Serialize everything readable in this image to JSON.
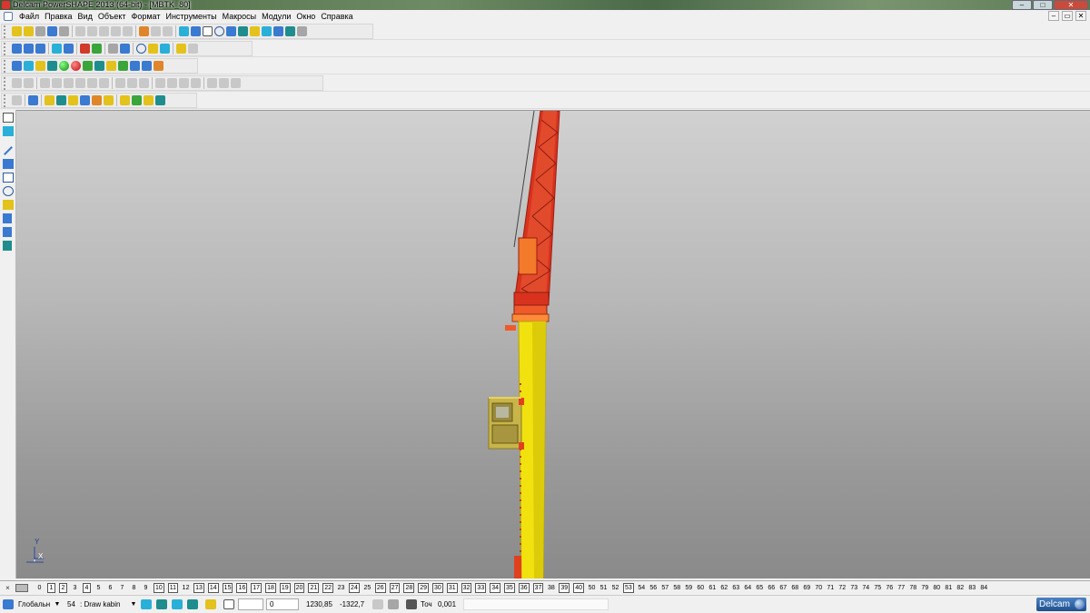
{
  "window": {
    "title": "Delcam PowerSHAPE 2013 (64-bit) - [MBTK_80]",
    "controls": {
      "minimize": "–",
      "maximize": "□",
      "close": "✕"
    }
  },
  "menu": {
    "items": [
      "Файл",
      "Правка",
      "Вид",
      "Объект",
      "Формат",
      "Инструменты",
      "Макросы",
      "Модули",
      "Окно",
      "Справка"
    ],
    "mdi_controls": {
      "minimize": "–",
      "restore": "▭",
      "close": "✕"
    }
  },
  "viewport": {
    "axis": {
      "x": "X",
      "y": "Y"
    },
    "colors": {
      "jib": "#d8321f",
      "tower": "#f1e20f",
      "cabin": "#c8b54a"
    }
  },
  "layers": {
    "close_glyph": "×",
    "numbers": [
      {
        "n": "0",
        "boxed": false
      },
      {
        "n": "1",
        "boxed": true
      },
      {
        "n": "2",
        "boxed": true
      },
      {
        "n": "3",
        "boxed": false
      },
      {
        "n": "4",
        "boxed": true
      },
      {
        "n": "5",
        "boxed": false
      },
      {
        "n": "6",
        "boxed": false
      },
      {
        "n": "7",
        "boxed": false
      },
      {
        "n": "8",
        "boxed": false
      },
      {
        "n": "9",
        "boxed": false
      },
      {
        "n": "10",
        "boxed": true
      },
      {
        "n": "11",
        "boxed": true
      },
      {
        "n": "12",
        "boxed": false
      },
      {
        "n": "13",
        "boxed": true
      },
      {
        "n": "14",
        "boxed": true
      },
      {
        "n": "15",
        "boxed": true
      },
      {
        "n": "16",
        "boxed": true
      },
      {
        "n": "17",
        "boxed": true
      },
      {
        "n": "18",
        "boxed": true
      },
      {
        "n": "19",
        "boxed": true
      },
      {
        "n": "20",
        "boxed": true
      },
      {
        "n": "21",
        "boxed": true
      },
      {
        "n": "22",
        "boxed": true
      },
      {
        "n": "23",
        "boxed": false
      },
      {
        "n": "24",
        "boxed": true
      },
      {
        "n": "25",
        "boxed": false
      },
      {
        "n": "26",
        "boxed": true
      },
      {
        "n": "27",
        "boxed": true
      },
      {
        "n": "28",
        "boxed": true
      },
      {
        "n": "29",
        "boxed": true
      },
      {
        "n": "30",
        "boxed": true
      },
      {
        "n": "31",
        "boxed": true
      },
      {
        "n": "32",
        "boxed": true
      },
      {
        "n": "33",
        "boxed": true
      },
      {
        "n": "34",
        "boxed": true
      },
      {
        "n": "35",
        "boxed": true
      },
      {
        "n": "36",
        "boxed": true
      },
      {
        "n": "37",
        "boxed": true
      },
      {
        "n": "38",
        "boxed": false
      },
      {
        "n": "39",
        "boxed": true
      },
      {
        "n": "40",
        "boxed": true
      },
      {
        "n": "50",
        "boxed": false
      },
      {
        "n": "51",
        "boxed": false
      },
      {
        "n": "52",
        "boxed": false
      },
      {
        "n": "53",
        "boxed": true
      },
      {
        "n": "54",
        "boxed": false
      },
      {
        "n": "56",
        "boxed": false
      },
      {
        "n": "57",
        "boxed": false
      },
      {
        "n": "58",
        "boxed": false
      },
      {
        "n": "59",
        "boxed": false
      },
      {
        "n": "60",
        "boxed": false
      },
      {
        "n": "61",
        "boxed": false
      },
      {
        "n": "62",
        "boxed": false
      },
      {
        "n": "63",
        "boxed": false
      },
      {
        "n": "64",
        "boxed": false
      },
      {
        "n": "65",
        "boxed": false
      },
      {
        "n": "66",
        "boxed": false
      },
      {
        "n": "67",
        "boxed": false
      },
      {
        "n": "68",
        "boxed": false
      },
      {
        "n": "69",
        "boxed": false
      },
      {
        "n": "70",
        "boxed": false
      },
      {
        "n": "71",
        "boxed": false
      },
      {
        "n": "72",
        "boxed": false
      },
      {
        "n": "73",
        "boxed": false
      },
      {
        "n": "74",
        "boxed": false
      },
      {
        "n": "75",
        "boxed": false
      },
      {
        "n": "76",
        "boxed": false
      },
      {
        "n": "77",
        "boxed": false
      },
      {
        "n": "78",
        "boxed": false
      },
      {
        "n": "79",
        "boxed": false
      },
      {
        "n": "80",
        "boxed": false
      },
      {
        "n": "81",
        "boxed": false
      },
      {
        "n": "82",
        "boxed": false
      },
      {
        "n": "83",
        "boxed": false
      },
      {
        "n": "84",
        "boxed": false
      }
    ]
  },
  "status": {
    "workplane": "Глобальн",
    "workplane_arrow": "▼",
    "layer_number": "54",
    "layer_name": ": Draw kabin",
    "layer_arrow": "▼",
    "field_value": "0",
    "coord_x": "1230,85",
    "coord_y": "-1322,7",
    "tolerance_label": "Точ",
    "tolerance_value": "0,001",
    "brand": "Delcam"
  }
}
